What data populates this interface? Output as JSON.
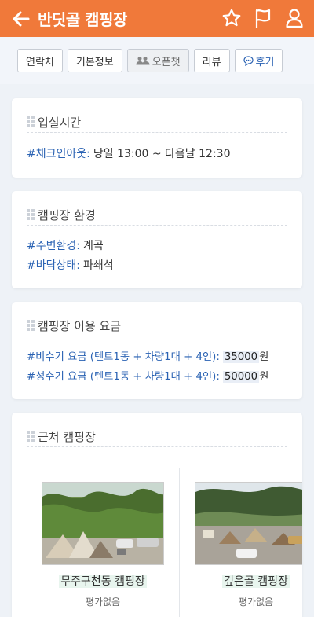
{
  "header": {
    "title": "반딧골 캠핑장",
    "colors": {
      "bar": "#f0793a",
      "accent": "#2a62b3"
    },
    "icons": [
      "back-arrow-icon",
      "star-icon",
      "flag-icon",
      "user-icon"
    ]
  },
  "tabs": [
    {
      "label": "연락처"
    },
    {
      "label": "기본정보"
    },
    {
      "label": "오픈챗"
    },
    {
      "label": "리뷰"
    },
    {
      "label": "후기"
    }
  ],
  "checkin": {
    "title": "입실시간",
    "tag": "#체크인아웃:",
    "value": "당일 13:00 ~  다음날 12:30"
  },
  "environment": {
    "title": "캠핑장 환경",
    "rows": [
      {
        "tag": "#주변환경:",
        "value": "계곡"
      },
      {
        "tag": "#바닥상태:",
        "value": "파쇄석"
      }
    ]
  },
  "pricing": {
    "title": "캠핑장 이용 요금",
    "rows": [
      {
        "tag": "#비수기 요금 (텐트1동 + 차량1대 + 4인):",
        "amount": "35000",
        "unit": "원"
      },
      {
        "tag": "#성수기 요금 (텐트1동 + 차량1대 + 4인):",
        "amount": "50000",
        "unit": "원"
      }
    ]
  },
  "nearby": {
    "title": "근처 캠핑장",
    "items": [
      {
        "name": "무주구천동 캠핑장",
        "rating": "평가없음"
      },
      {
        "name": "깊은골 캠핑장",
        "rating": "평가없음"
      }
    ]
  }
}
